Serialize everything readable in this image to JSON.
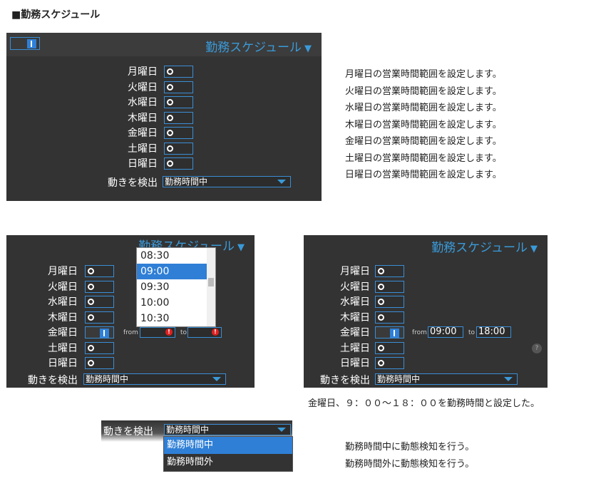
{
  "heading": "■勤務スケジュール",
  "panel_title": "勤務スケジュール",
  "days": [
    "月曜日",
    "火曜日",
    "水曜日",
    "木曜日",
    "金曜日",
    "土曜日",
    "日曜日"
  ],
  "motion_label": "動きを検出",
  "motion_value": "勤務時間中",
  "descriptions": [
    "月曜日の営業時間範囲を設定します。",
    "火曜日の営業時間範囲を設定します。",
    "水曜日の営業時間範囲を設定します。",
    "木曜日の営業時間範囲を設定します。",
    "金曜日の営業時間範囲を設定します。",
    "土曜日の営業時間範囲を設定します。",
    "日曜日の営業時間範囲を設定します。"
  ],
  "time_options": [
    "08:30",
    "09:00",
    "09:30",
    "10:00",
    "10:30"
  ],
  "selected_time": "09:00",
  "from_label": "from",
  "to_label": "to",
  "from_value": "09:00",
  "to_value": "18:00",
  "error_mark": "!",
  "help_mark": "?",
  "friday_note": "金曜日、９：００～１８：００を勤務時間と設定した。",
  "motion_options": [
    "勤務時間中",
    "勤務時間外"
  ],
  "motion_descriptions": [
    "勤務時間中に動態検知を行う。",
    "勤務時間外に動態検知を行う。"
  ]
}
